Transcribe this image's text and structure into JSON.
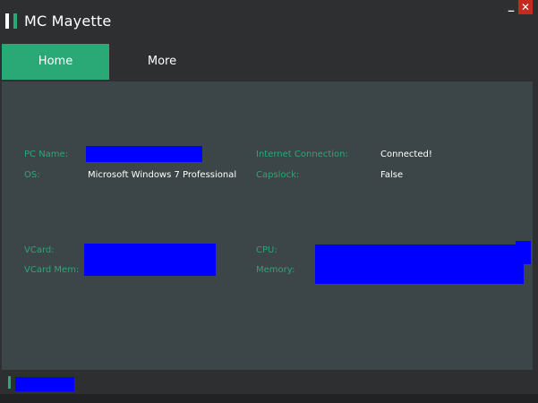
{
  "window": {
    "title": "MC Mayette",
    "minimize_label": "_",
    "close_label": "✕"
  },
  "tabs": [
    {
      "label": "Home",
      "active": true
    },
    {
      "label": "More",
      "active": false
    }
  ],
  "colors": {
    "accent": "#2aa876",
    "content_bg": "#3c4547",
    "chrome_bg": "#2d2f31",
    "redaction": "#0000ff",
    "close": "#c42b1c"
  },
  "info": {
    "pc_name_label": "PC Name:",
    "os_label": "OS:",
    "os_value": "Microsoft Windows 7 Professional",
    "internet_label": "Internet Connection:",
    "internet_value": "Connected!",
    "capslock_label": "Capslock:",
    "capslock_value": "False",
    "vcard_label": "VCard:",
    "vcard_mem_label": "VCard Mem:",
    "cpu_label": "CPU:",
    "memory_label": "Memory:"
  }
}
